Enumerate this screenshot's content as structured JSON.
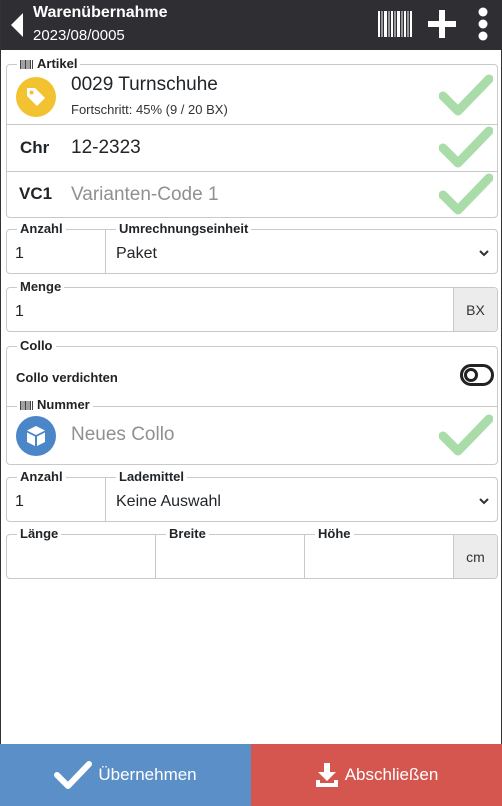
{
  "header": {
    "title": "Warenübernahme",
    "subtitle": "2023/08/0005",
    "icons": [
      "back-arrow-icon",
      "barcode-icon",
      "plus-icon",
      "more-vertical-icon"
    ]
  },
  "artikel": {
    "legend": "Artikel",
    "name": "0029 Turnschuhe",
    "progress_text": "Fortschritt: 45% (9 / 20 BX)",
    "progress_fraction": 0.45,
    "chr_label": "Chr",
    "chr_value": "12-2323",
    "vc_label": "VC1",
    "vc_placeholder": "Varianten-Code 1"
  },
  "unit_row": {
    "anzahl_label": "Anzahl",
    "anzahl_value": "1",
    "unit_label": "Umrechnungseinheit",
    "unit_value": "Paket"
  },
  "menge": {
    "label": "Menge",
    "value": "1",
    "unit": "BX"
  },
  "collo": {
    "legend": "Collo",
    "compress_label": "Collo verdichten",
    "compress_enabled": false,
    "nummer_legend": "Nummer",
    "nummer_placeholder": "Neues Collo"
  },
  "lade_row": {
    "anzahl_label": "Anzahl",
    "anzahl_value": "1",
    "lademittel_label": "Lademittel",
    "lademittel_value": "Keine Auswahl"
  },
  "dimensions": {
    "laenge_label": "Länge",
    "breite_label": "Breite",
    "hoehe_label": "Höhe",
    "unit": "cm"
  },
  "footer": {
    "accept_label": "Übernehmen",
    "finish_label": "Abschließen"
  },
  "colors": {
    "header_bg": "#2f2f33",
    "tag_icon": "#f2c230",
    "collo_icon": "#4a86c8",
    "check": "#a9dca9",
    "accept_bg": "#5b8fc7",
    "finish_bg": "#d5554f"
  }
}
